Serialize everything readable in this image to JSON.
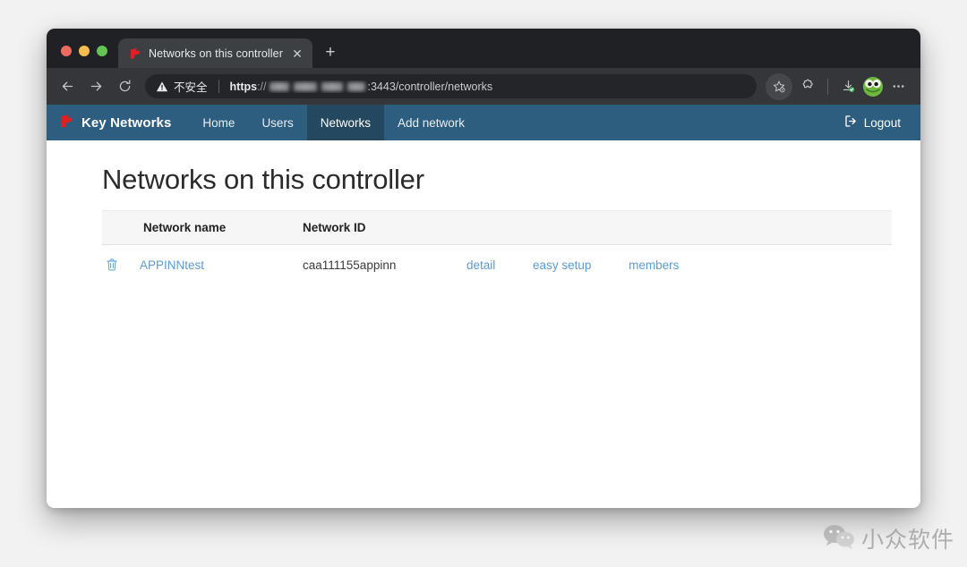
{
  "browser": {
    "tab": {
      "title": "Networks on this controller",
      "favicon_icon": "key-networks-logo-icon",
      "close_icon": "close-icon"
    },
    "new_tab_icon": "plus-icon",
    "traffic_lights": [
      "close-red",
      "minimize-yellow",
      "maximize-green"
    ],
    "nav": {
      "back_icon": "arrow-left-icon",
      "forward_icon": "arrow-right-icon",
      "reload_icon": "reload-icon"
    },
    "omnibox": {
      "security_icon": "warning-triangle-icon",
      "security_label": "不安全",
      "url_scheme": "https",
      "url_separator": "://",
      "url_host_redacted": "[blurred host]",
      "url_rest": ":3443/controller/networks"
    },
    "toolbar_icons": [
      {
        "name": "bookmark-star-icon",
        "label": "Bookmark this tab"
      },
      {
        "name": "extensions-puzzle-icon",
        "label": "Extensions"
      },
      {
        "name": "download-complete-icon",
        "label": "Downloads"
      },
      {
        "name": "profile-avatar-frog-icon",
        "label": "Profile"
      },
      {
        "name": "more-menu-icon",
        "label": "Customize and control"
      }
    ]
  },
  "app": {
    "brand": {
      "logo_icon": "key-networks-logo-icon",
      "name": "Key Networks"
    },
    "nav_items": [
      {
        "label": "Home",
        "active": false
      },
      {
        "label": "Users",
        "active": false
      },
      {
        "label": "Networks",
        "active": true
      },
      {
        "label": "Add network",
        "active": false
      }
    ],
    "logout": {
      "label": "Logout",
      "icon": "sign-out-icon"
    },
    "colors": {
      "navbar": "#2d5d7f",
      "navbar_active": "#23485f",
      "link": "#5b9bd5",
      "brand_logo": "#e02020"
    }
  },
  "page": {
    "title": "Networks on this controller",
    "table": {
      "columns": [
        "",
        "Network name",
        "Network ID",
        ""
      ],
      "rows": [
        {
          "delete_icon": "trash-icon",
          "network_name": "APPINNtest",
          "network_id": "caa111155appinn",
          "actions": [
            "detail",
            "easy setup",
            "members"
          ]
        }
      ]
    }
  },
  "watermark": {
    "icon": "wechat-icon",
    "text": "小众软件"
  }
}
